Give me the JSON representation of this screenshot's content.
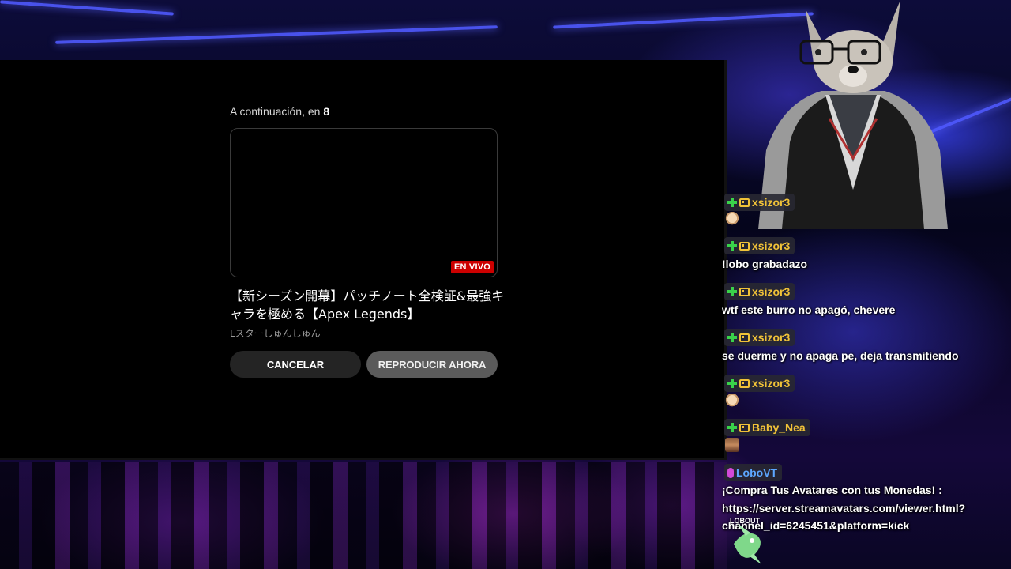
{
  "upnext": {
    "prefix": "A continuación, en",
    "countdown": "8",
    "live_badge": "EN VIVO",
    "video_title": "【新シーズン開幕】パッチノート全検証&最強キャラを極める【Apex Legends】",
    "channel": "Lスターしゅんしゅん",
    "cancel_label": "CANCELAR",
    "play_label": "REPRODUCIR AHORA"
  },
  "chat": {
    "messages": [
      {
        "user": "xsizor3",
        "text": "",
        "emote": "dog-emote"
      },
      {
        "user": "xsizor3",
        "text": "!lobo grabadazo"
      },
      {
        "user": "xsizor3",
        "text": "wtf este burro no apagó, chevere"
      },
      {
        "user": "xsizor3",
        "text": "se duerme y no apaga pe, deja transmitiendo"
      },
      {
        "user": "xsizor3",
        "text": "",
        "emote": "dog-emote"
      },
      {
        "user": "Baby_Nea",
        "text": "",
        "emote": "face-emote"
      },
      {
        "user": "LoboVT",
        "text_lines": [
          "¡Compra Tus Avatares con tus Monedas! :",
          "https://server.streamavatars.com/viewer.html?",
          "channel_id=6245451&platform=kick"
        ]
      }
    ],
    "mascot_label": "LOBOUT"
  },
  "colors": {
    "name_gold": "#f0c238",
    "name_blue": "#5da7ff",
    "live_red": "#cc0000",
    "button_dark": "#242424",
    "button_gray": "#5b5b5b"
  }
}
